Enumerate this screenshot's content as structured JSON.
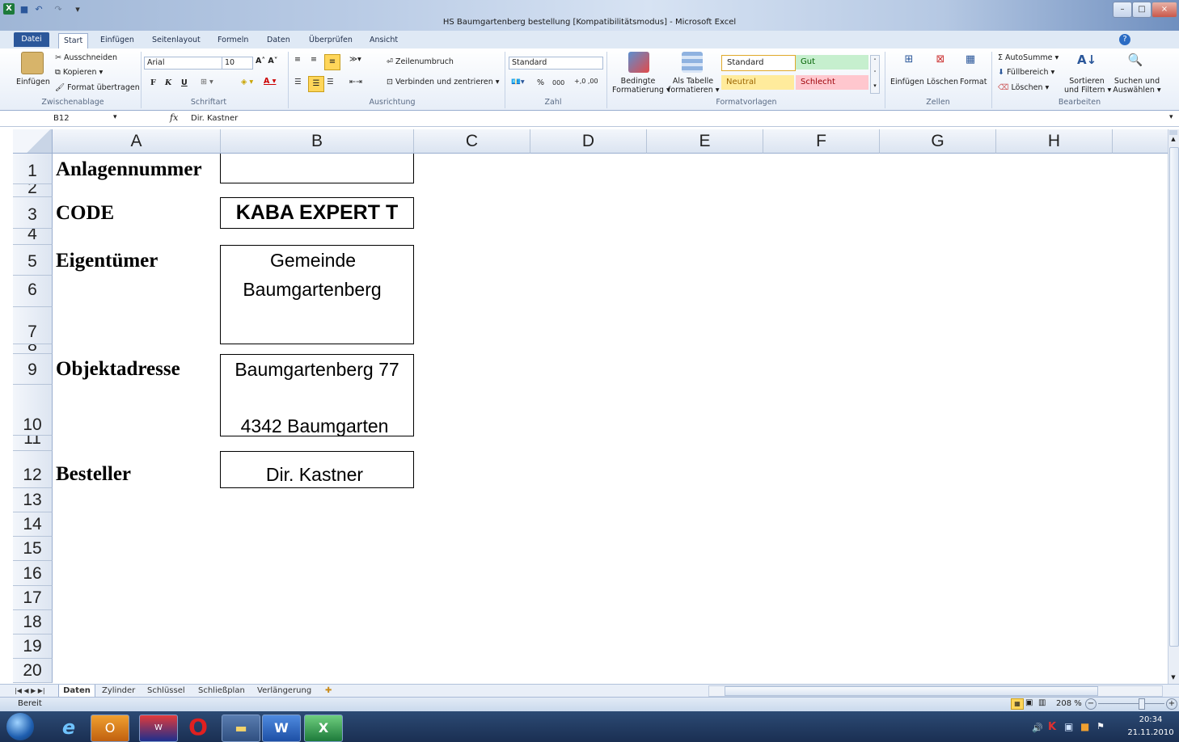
{
  "window": {
    "title": "HS Baumgartenberg bestellung  [Kompatibilitätsmodus]  -  Microsoft Excel",
    "min": "–",
    "max": "□",
    "close": "⨯"
  },
  "ribbon": {
    "tabs": [
      "Datei",
      "Start",
      "Einfügen",
      "Seitenlayout",
      "Formeln",
      "Daten",
      "Überprüfen",
      "Ansicht"
    ],
    "clipboard": {
      "paste": "Einfügen",
      "cut": "Ausschneiden",
      "copy": "Kopieren",
      "format_painter": "Format übertragen",
      "label": "Zwischenablage"
    },
    "font": {
      "name": "Arial",
      "size": "10",
      "bold": "F",
      "italic": "K",
      "underline": "U",
      "label": "Schriftart"
    },
    "alignment": {
      "wrap": "Zeilenumbruch",
      "merge": "Verbinden und zentrieren",
      "label": "Ausrichtung"
    },
    "number": {
      "format": "Standard",
      "percent": "%",
      "thousands": "000",
      "label": "Zahl"
    },
    "styles": {
      "conditional_1": "Bedingte",
      "conditional_2": "Formatierung",
      "table_1": "Als Tabelle",
      "table_2": "formatieren",
      "standard": "Standard",
      "gut": "Gut",
      "neutral": "Neutral",
      "schlecht": "Schlecht",
      "label": "Formatvorlagen"
    },
    "cells": {
      "insert": "Einfügen",
      "delete": "Löschen",
      "format": "Format",
      "label": "Zellen"
    },
    "editing": {
      "autosum": "AutoSumme",
      "fill": "Füllbereich",
      "clear": "Löschen",
      "sort_1": "Sortieren",
      "sort_2": "und Filtern",
      "find_1": "Suchen und",
      "find_2": "Auswählen",
      "label": "Bearbeiten"
    }
  },
  "formula": {
    "namebox": "B12",
    "fx": "fx",
    "value": "Dir. Kastner"
  },
  "grid": {
    "columns": [
      "A",
      "B",
      "C",
      "D",
      "E",
      "F",
      "G",
      "H"
    ],
    "rows": [
      "1",
      "2",
      "3",
      "4",
      "5",
      "6",
      "7",
      "8",
      "9",
      "10",
      "11",
      "12",
      "13",
      "14",
      "15",
      "16",
      "17",
      "18",
      "19",
      "20"
    ],
    "cells": {
      "a1": "Anlagennummer",
      "a3": "CODE",
      "b3": "KABA EXPERT T",
      "a5": "Eigentümer",
      "b5": "Gemeinde",
      "b6": "Baumgartenberg",
      "a9": "Objektadresse",
      "b9": "Baumgartenberg 77",
      "b10": "4342 Baumgarten",
      "a12": "Besteller",
      "b12": "Dir. Kastner"
    }
  },
  "sheets": [
    "Daten",
    "Zylinder",
    "Schlüssel",
    "Schließplan",
    "Verlängerung"
  ],
  "status": {
    "ready": "Bereit",
    "zoom": "208 %"
  },
  "taskbar": {
    "time": "20:34",
    "date": "21.11.2010"
  }
}
